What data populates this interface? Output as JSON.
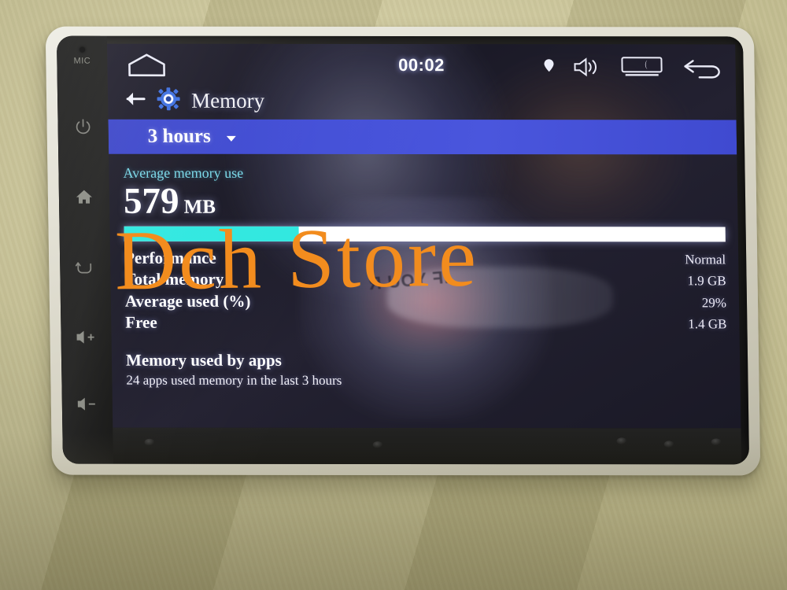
{
  "device": {
    "hard_keys": {
      "mic_label": "MIC",
      "items": [
        {
          "name": "power-key",
          "icon": "power-icon"
        },
        {
          "name": "home-key",
          "icon": "home-icon"
        },
        {
          "name": "back-key",
          "icon": "back-arrow-icon"
        },
        {
          "name": "volume-up-key",
          "icon": "volume-up-icon",
          "label": "+"
        },
        {
          "name": "volume-down-key",
          "icon": "volume-down-icon",
          "label": "-"
        }
      ]
    }
  },
  "status_bar": {
    "home_icon": "home-outline-icon",
    "clock": "00:02",
    "icons": [
      {
        "name": "location-pin-icon"
      },
      {
        "name": "volume-speaker-icon"
      },
      {
        "name": "screen-brightness-icon"
      },
      {
        "name": "return-arrow-icon"
      }
    ]
  },
  "action_bar": {
    "back_icon": "back-arrow-icon",
    "app_icon": "settings-gear-icon",
    "title": "Memory"
  },
  "spinner": {
    "value": "3 hours",
    "caret_icon": "chevron-down-icon"
  },
  "main": {
    "average_label": "Average memory use",
    "average_value": "579",
    "average_unit": "MB",
    "usage_percent": 29,
    "stats": [
      {
        "label": "Performance",
        "value": "Normal"
      },
      {
        "label": "Total memory",
        "value": "1.9 GB"
      },
      {
        "label": "Average used (%)",
        "value": "29%"
      },
      {
        "label": "Free",
        "value": "1.4 GB"
      }
    ],
    "apps_heading": "Memory used by apps",
    "apps_subtitle": "24 apps used memory in the last 3 hours"
  },
  "reflection": {
    "shirt_text": "IF YOU R"
  },
  "watermark": {
    "text": "Dch Store",
    "color": "#f28c1e"
  },
  "colors": {
    "accent_blue": "#4450d8",
    "bar_fill": "#30e8e0",
    "label_cyan": "#79d8e8",
    "bezel": "#e3e1d5"
  }
}
